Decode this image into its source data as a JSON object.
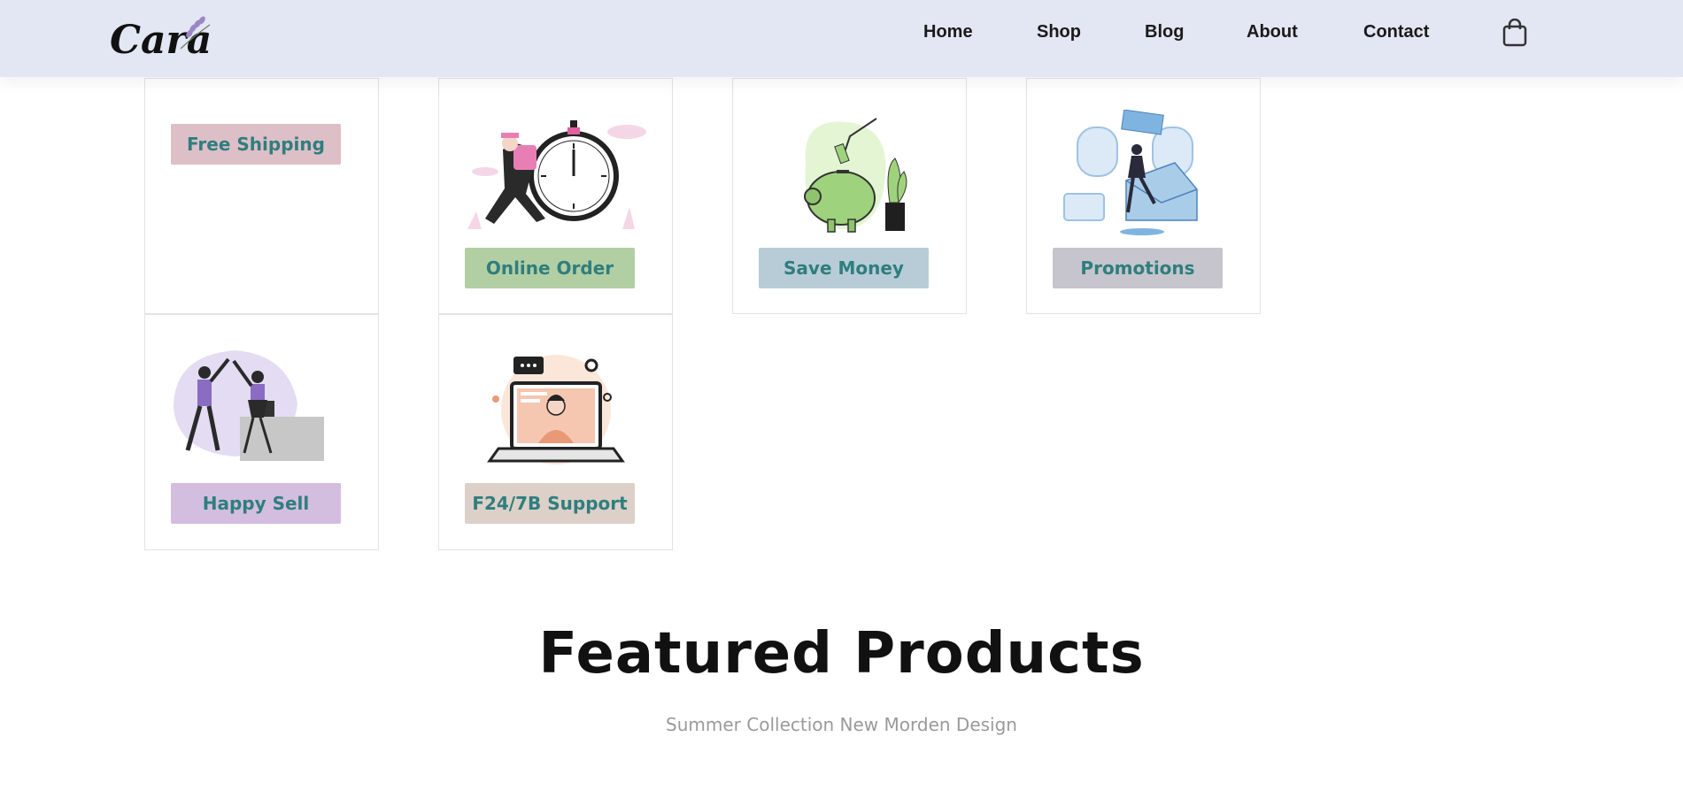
{
  "header": {
    "logo_text": "Cara",
    "nav": [
      {
        "label": "Home"
      },
      {
        "label": "Shop"
      },
      {
        "label": "Blog"
      },
      {
        "label": "About"
      },
      {
        "label": "Contact"
      }
    ],
    "cart_icon": "shopping-bag-icon",
    "background": "#e3e6f3"
  },
  "features": [
    {
      "label": "Free Shipping",
      "icon": "free-shipping-icon",
      "color": "#ddbfc7"
    },
    {
      "label": "Online Order",
      "icon": "online-order-icon",
      "color": "#b2cfa3"
    },
    {
      "label": "Save Money",
      "icon": "save-money-icon",
      "color": "#b7ccd7"
    },
    {
      "label": "Promotions",
      "icon": "promotions-icon",
      "color": "#c6c5cd"
    },
    {
      "label": "Happy Sell",
      "icon": "happy-sell-icon",
      "color": "#d3bedf"
    },
    {
      "label": "F24/7B Support",
      "icon": "support-icon",
      "color": "#dcd0c8"
    }
  ],
  "featured": {
    "title": "Featured Products",
    "subtitle": "Summer Collection New Morden Design"
  },
  "colors": {
    "label_text": "#2f7e7e"
  }
}
